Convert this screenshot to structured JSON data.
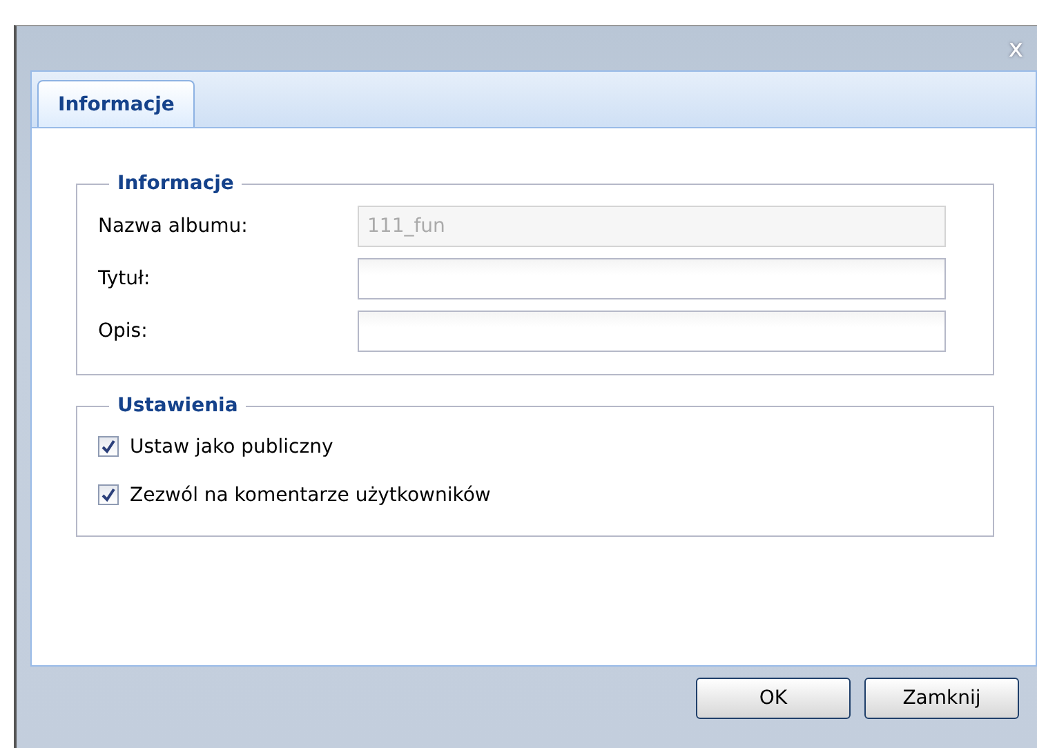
{
  "dialog": {
    "close": "x"
  },
  "tabs": [
    {
      "label": "Informacje",
      "selected": true
    }
  ],
  "info_group": {
    "legend": "Informacje",
    "fields": [
      {
        "label": "Nazwa albumu:",
        "value": "111_fun",
        "disabled": true
      },
      {
        "label": "Tytuł:",
        "disabled": false
      },
      {
        "label": "Opis:",
        "disabled": false
      }
    ]
  },
  "settings_group": {
    "legend": "Ustawienia",
    "options": [
      {
        "label": "Ustaw jako publiczny",
        "checked": true
      },
      {
        "label": "Zezwól na komentarze użytkowników",
        "checked": true
      }
    ]
  },
  "buttons": [
    "OK",
    "Zamknij"
  ]
}
